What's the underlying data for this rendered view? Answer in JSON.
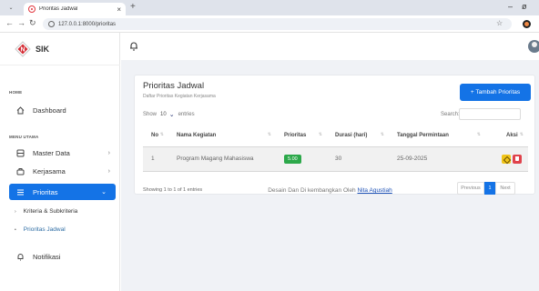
{
  "browser": {
    "tab_title": "Prioritas Jadwal",
    "tab_close": "×",
    "new_tab": "+",
    "url": "127.0.0.1:8000/prioritas",
    "min": "–",
    "restore": "ø"
  },
  "brand": {
    "name": "SIK"
  },
  "sidebar": {
    "home_label": "HOME",
    "dashboard": "Dashboard",
    "menu_label": "MENU UTAMA",
    "items": [
      {
        "label": "Master Data"
      },
      {
        "label": "Kerjasama"
      },
      {
        "label": "Prioritas"
      }
    ],
    "sub_items": [
      {
        "label": "Kriteria & Subkriteria"
      },
      {
        "label": "Prioritas Jadwal"
      }
    ],
    "notifikasi": "Notifikasi"
  },
  "page": {
    "title": "Prioritas Jadwal",
    "subtitle": "Daftar Prioritas Kegiatan Kerjasama",
    "add_button": "+ Tambah Prioritas",
    "show_label": "Show",
    "show_value": "10",
    "entries_label": "entries",
    "search_label": "Search:"
  },
  "table": {
    "headers": [
      "No",
      "Nama Kegiatan",
      "Prioritas",
      "Durasi (hari)",
      "Tanggal Permintaan",
      "Aksi"
    ],
    "rows": [
      {
        "no": "1",
        "nama": "Program Magang Mahasiswa",
        "prioritas": "5.00",
        "durasi": "30",
        "tanggal": "25-09-2025"
      }
    ],
    "info": "Showing 1 to 1 of 1 entries",
    "pager": {
      "prev": "Previous",
      "current": "1",
      "next": "Next"
    }
  },
  "footer": {
    "text": "Desain Dan Di kembangkan Oleh ",
    "author": "Nita Agustiah"
  },
  "colors": {
    "primary": "#1473e6",
    "badge": "#2ca84a",
    "edit": "#f0c419",
    "delete": "#e0424b"
  }
}
